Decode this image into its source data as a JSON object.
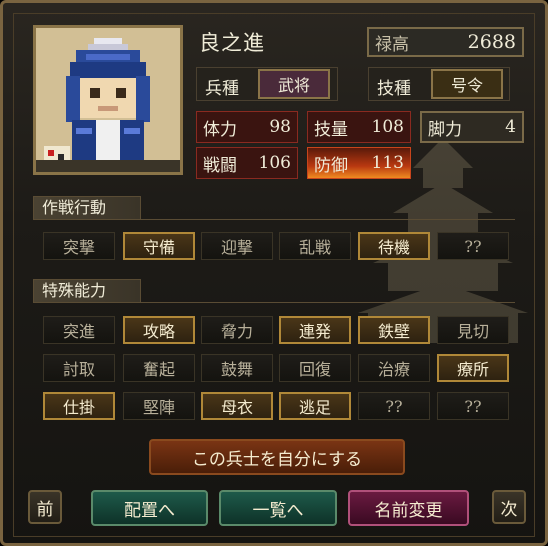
{
  "character": {
    "name": "良之進",
    "salary_label": "禄高",
    "salary_value": "2688",
    "troop_type_label": "兵種",
    "troop_type_value": "武将",
    "skill_type_label": "技種",
    "skill_type_value": "号令"
  },
  "stats": [
    {
      "label": "体力",
      "value": "98"
    },
    {
      "label": "技量",
      "value": "108"
    },
    {
      "label": "脚力",
      "value": "4"
    },
    {
      "label": "戦闘",
      "value": "106"
    },
    {
      "label": "防御",
      "value": "113"
    }
  ],
  "sections": {
    "tactics_title": "作戦行動",
    "abilities_title": "特殊能力"
  },
  "tactics": [
    {
      "label": "突撃",
      "active": false
    },
    {
      "label": "守備",
      "active": true
    },
    {
      "label": "迎撃",
      "active": false
    },
    {
      "label": "乱戦",
      "active": false
    },
    {
      "label": "待機",
      "active": true
    },
    {
      "label": "??",
      "active": false
    }
  ],
  "abilities": [
    {
      "label": "突進",
      "active": false
    },
    {
      "label": "攻略",
      "active": true
    },
    {
      "label": "脅力",
      "active": false
    },
    {
      "label": "連発",
      "active": true
    },
    {
      "label": "鉄壁",
      "active": true
    },
    {
      "label": "見切",
      "active": false
    },
    {
      "label": "討取",
      "active": false
    },
    {
      "label": "奮起",
      "active": false
    },
    {
      "label": "鼓舞",
      "active": false
    },
    {
      "label": "回復",
      "active": false
    },
    {
      "label": "治療",
      "active": false
    },
    {
      "label": "療所",
      "active": true
    },
    {
      "label": "仕掛",
      "active": true
    },
    {
      "label": "堅陣",
      "active": false
    },
    {
      "label": "母衣",
      "active": true
    },
    {
      "label": "逃足",
      "active": true
    },
    {
      "label": "??",
      "active": false
    },
    {
      "label": "??",
      "active": false
    }
  ],
  "buttons": {
    "make_mine": "この兵士を自分にする",
    "prev": "前",
    "to_placement": "配置へ",
    "to_list": "一覧へ",
    "rename": "名前変更",
    "next": "次"
  }
}
